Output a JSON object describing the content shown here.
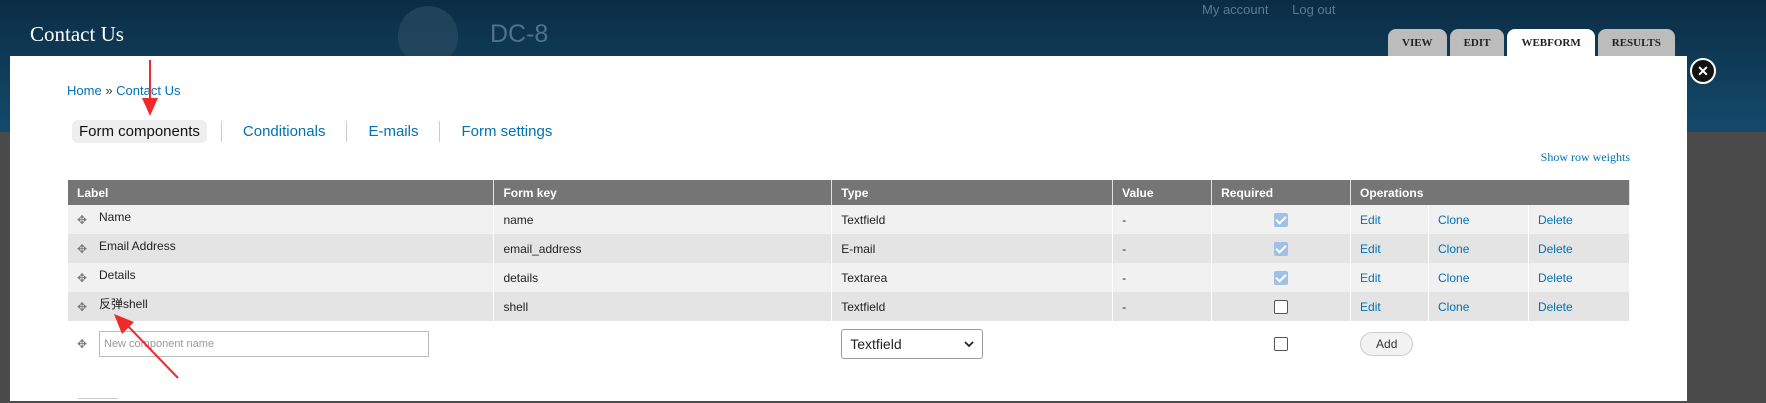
{
  "header": {
    "page_title": "Contact Us",
    "site_name": "DC-8",
    "user_links": [
      "My account",
      "Log out"
    ],
    "tabs": [
      {
        "label": "VIEW",
        "active": false
      },
      {
        "label": "EDIT",
        "active": false
      },
      {
        "label": "WEBFORM",
        "active": true
      },
      {
        "label": "RESULTS",
        "active": false
      }
    ]
  },
  "overlay": {
    "close_glyph": "✕",
    "breadcrumb": {
      "home": "Home",
      "separator": "»",
      "current": "Contact Us"
    },
    "secondary_tabs": [
      {
        "label": "Form components",
        "active": true
      },
      {
        "label": "Conditionals",
        "active": false
      },
      {
        "label": "E-mails",
        "active": false
      },
      {
        "label": "Form settings",
        "active": false
      }
    ],
    "show_row_weights": "Show row weights",
    "table": {
      "headers": [
        "Label",
        "Form key",
        "Type",
        "Value",
        "Required",
        "Operations"
      ],
      "rows": [
        {
          "label": "Name",
          "form_key": "name",
          "type": "Textfield",
          "value": "-",
          "required": true
        },
        {
          "label": "Email Address",
          "form_key": "email_address",
          "type": "E-mail",
          "value": "-",
          "required": true
        },
        {
          "label": "Details",
          "form_key": "details",
          "type": "Textarea",
          "value": "-",
          "required": true
        },
        {
          "label": "反弹shell",
          "form_key": "shell",
          "type": "Textfield",
          "value": "-",
          "required": false
        }
      ],
      "operations": [
        "Edit",
        "Clone",
        "Delete"
      ],
      "new_row": {
        "name_placeholder": "New component name",
        "type_selected": "Textfield",
        "required": false,
        "add_label": "Add"
      }
    }
  },
  "annotations": {
    "arrow_color": "#ee2a2a"
  },
  "icons": {
    "drag": "move-icon",
    "close": "close-icon",
    "select": "chevron-down-icon"
  }
}
